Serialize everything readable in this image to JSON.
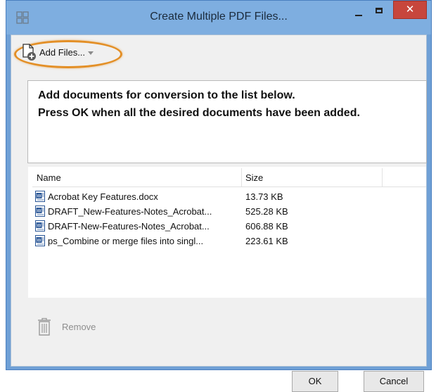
{
  "window": {
    "title": "Create Multiple PDF Files...",
    "close_glyph": "✕"
  },
  "toolbar": {
    "add_files_label": "Add Files...",
    "add_files_icon": "document-plus-icon",
    "highlight_color": "#e38f26"
  },
  "instructions": {
    "line1": "Add documents for conversion to the list below.",
    "line2": "Press OK when all the desired documents have been added."
  },
  "table": {
    "columns": [
      "Name",
      "Size"
    ],
    "rows": [
      {
        "name": "Acrobat Key Features.docx",
        "size": "13.73 KB"
      },
      {
        "name": "DRAFT_New-Features-Notes_Acrobat...",
        "size": "525.28 KB"
      },
      {
        "name": "DRAFT-New-Features-Notes_Acrobat...",
        "size": "606.88 KB"
      },
      {
        "name": "ps_Combine or merge files into singl...",
        "size": "223.61 KB"
      }
    ]
  },
  "actions": {
    "remove_label": "Remove",
    "ok_label": "OK",
    "cancel_label": "Cancel"
  },
  "colors": {
    "titlebar": "#7eaee0",
    "close_button": "#c7463c",
    "word_icon": "#2b5797"
  }
}
